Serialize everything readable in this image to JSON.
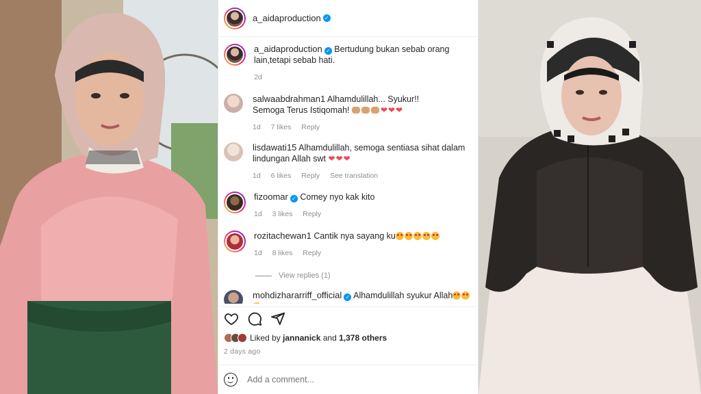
{
  "post": {
    "author": "a_aidaproduction",
    "caption": "Bertudung bukan sebab orang lain,tetapi sebab hati.",
    "caption_age": "2d"
  },
  "comments": [
    {
      "user": "salwaabdrahman1",
      "text_line1": "Alhamdulillah... Syukur!!",
      "text_line2": "Semoga Terus Istiqomah!",
      "age": "1d",
      "likes": "7 likes",
      "reply": "Reply"
    },
    {
      "user": "lisdawati15",
      "text_line1": "Alhamdulillah, semoga sentiasa sihat dalam",
      "text_line2": "lindungan Allah swt",
      "age": "1d",
      "likes": "6 likes",
      "reply": "Reply",
      "translation": "See translation"
    },
    {
      "user": "fizoomar",
      "text_line1": "Comey nyo kak kito",
      "age": "1d",
      "likes": "3 likes",
      "reply": "Reply"
    },
    {
      "user": "rozitachewan1",
      "text_line1": "Cantik nya sayang ku",
      "age": "1d",
      "likes": "8 likes",
      "reply": "Reply"
    },
    {
      "user": "mohdizhararriff_official",
      "text_line1": "Alhamdulillah syukur Allah"
    }
  ],
  "view_replies": "View replies (1)",
  "liked_by": {
    "prefix": "Liked by",
    "user": "jannanick",
    "connector": "and",
    "others": "1,378 others"
  },
  "posted": "2 days ago",
  "add_comment_placeholder": "Add a comment...",
  "icons": [
    "heart-icon",
    "comment-icon",
    "share-icon",
    "emoji-icon"
  ],
  "colors": {
    "verified": "#0095f6",
    "heart": "#ed4956",
    "muted": "#8e8e8e"
  }
}
